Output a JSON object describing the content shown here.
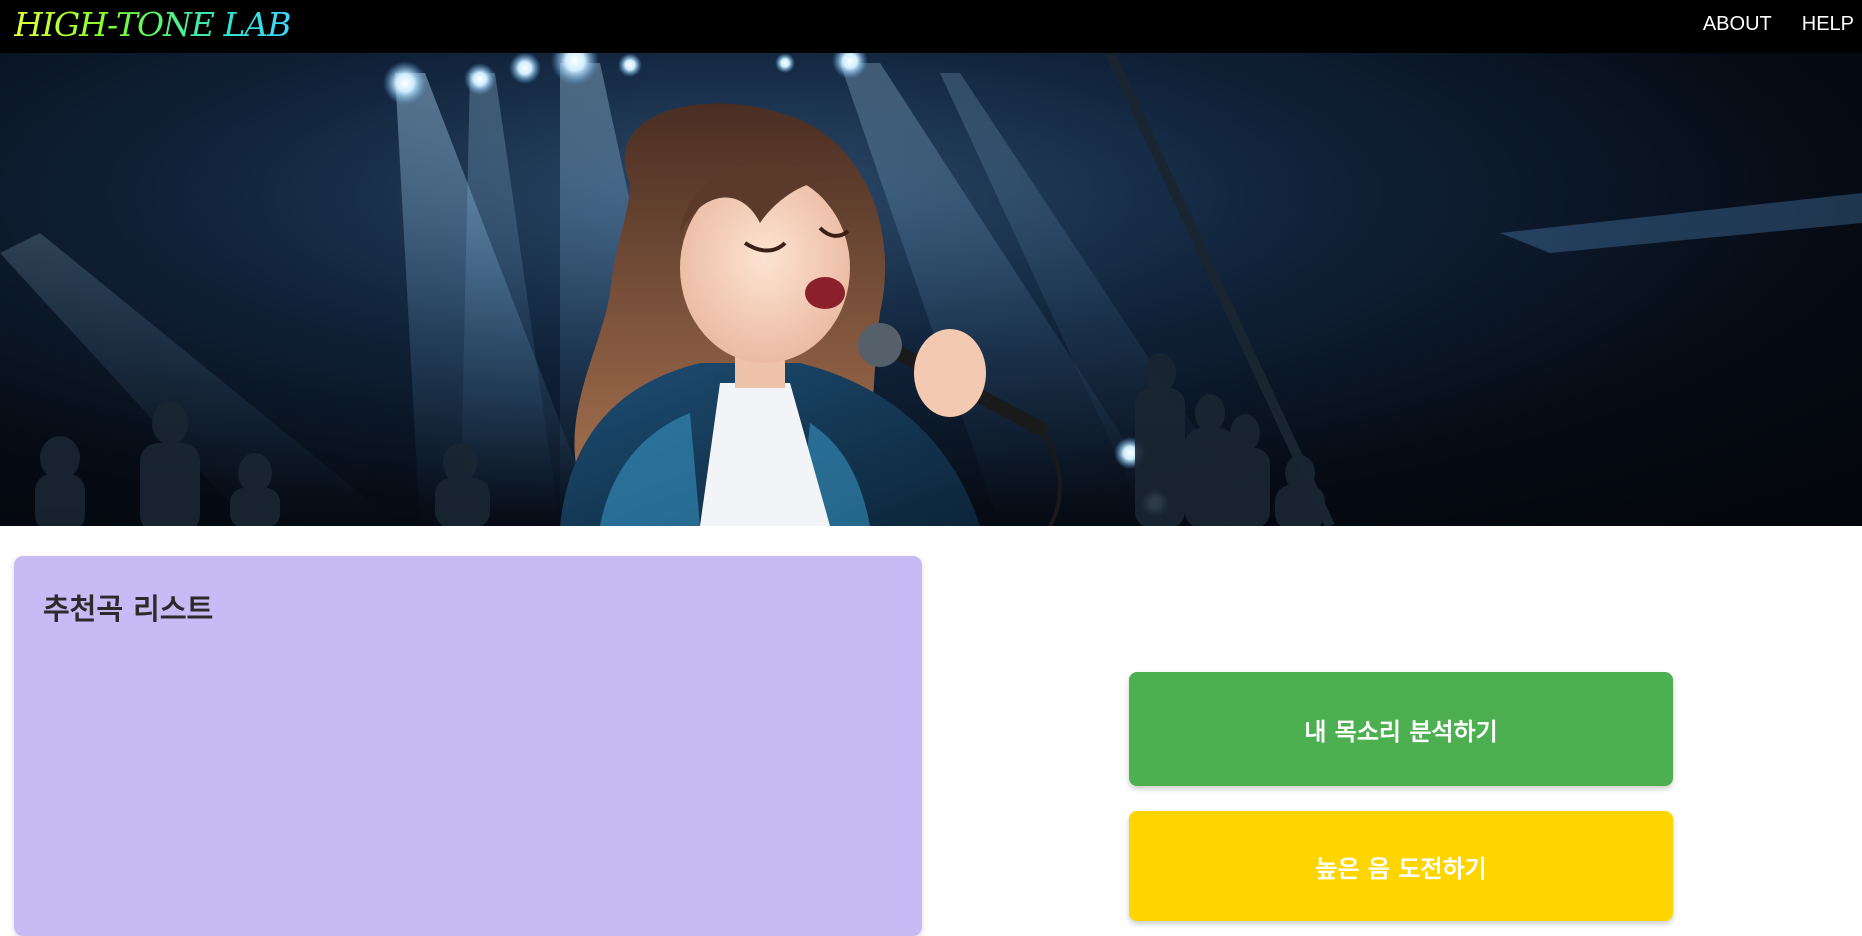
{
  "header": {
    "logo": "HIGH-TONE LAB",
    "nav": [
      "ABOUT",
      "HELP"
    ]
  },
  "hero": {
    "image_description_icon": "singer-on-stage-image"
  },
  "recommend": {
    "title": "추천곡 리스트"
  },
  "actions": {
    "analyze_label": "내 목소리 분석하기",
    "challenge_label": "높은 음 도전하기"
  },
  "colors": {
    "topbar": "#000000",
    "panel": "#c7bbf5",
    "analyze": "#4caf50",
    "challenge": "#ffd500"
  }
}
